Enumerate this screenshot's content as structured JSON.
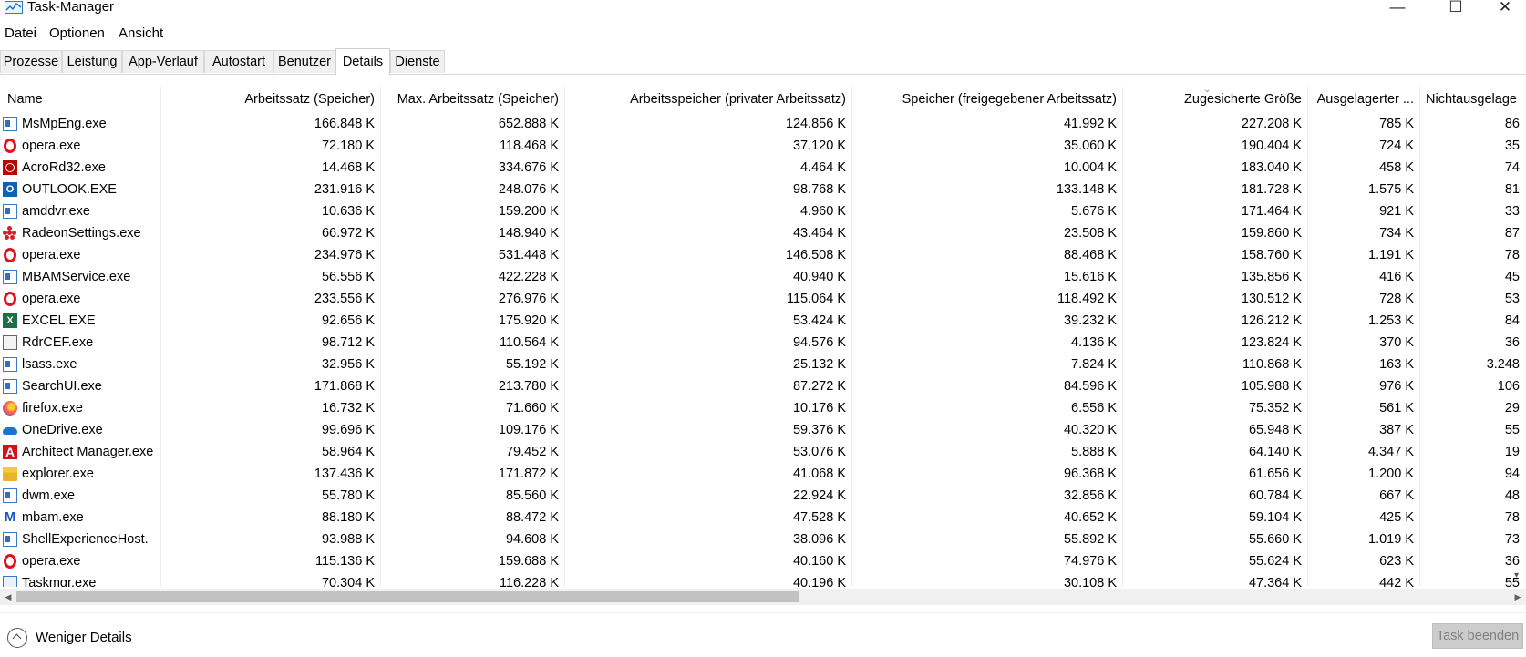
{
  "window": {
    "title": "Task-Manager",
    "app_icon": "task-manager-icon",
    "controls": {
      "minimize": "—",
      "maximize": "☐",
      "close": "✕"
    }
  },
  "menu": [
    "Datei",
    "Optionen",
    "Ansicht"
  ],
  "tabs": [
    {
      "label": "Prozesse"
    },
    {
      "label": "Leistung"
    },
    {
      "label": "App-Verlauf"
    },
    {
      "label": "Autostart"
    },
    {
      "label": "Benutzer"
    },
    {
      "label": "Details",
      "active": true
    },
    {
      "label": "Dienste"
    }
  ],
  "table": {
    "columns": [
      "Name",
      "Arbeitssatz (Speicher)",
      "Max. Arbeitssatz (Speicher)",
      "Arbeitsspeicher (privater Arbeitssatz)",
      "Speicher (freigegebener Arbeitssatz)",
      "Zugesicherte Größe",
      "Ausgelagerter ...",
      "Nichtausgelage"
    ],
    "sorted_column": "Zugesicherte Größe",
    "rows": [
      {
        "name": "MsMpEng.exe",
        "icon": "window-icon",
        "ws": "166.848 K",
        "max_ws": "652.888 K",
        "private": "124.856 K",
        "shared": "41.992 K",
        "commit": "227.208 K",
        "paged": "785 K",
        "nonpaged": "86"
      },
      {
        "name": "opera.exe",
        "icon": "opera-icon",
        "ws": "72.180 K",
        "max_ws": "118.468 K",
        "private": "37.120 K",
        "shared": "35.060 K",
        "commit": "190.404 K",
        "paged": "724 K",
        "nonpaged": "35"
      },
      {
        "name": "AcroRd32.exe",
        "icon": "acrobat-icon",
        "ws": "14.468 K",
        "max_ws": "334.676 K",
        "private": "4.464 K",
        "shared": "10.004 K",
        "commit": "183.040 K",
        "paged": "458 K",
        "nonpaged": "74"
      },
      {
        "name": "OUTLOOK.EXE",
        "icon": "outlook-icon",
        "ws": "231.916 K",
        "max_ws": "248.076 K",
        "private": "98.768 K",
        "shared": "133.148 K",
        "commit": "181.728 K",
        "paged": "1.575 K",
        "nonpaged": "81"
      },
      {
        "name": "amddvr.exe",
        "icon": "window-icon",
        "ws": "10.636 K",
        "max_ws": "159.200 K",
        "private": "4.960 K",
        "shared": "5.676 K",
        "commit": "171.464 K",
        "paged": "921 K",
        "nonpaged": "33"
      },
      {
        "name": "RadeonSettings.exe",
        "icon": "radeon-icon",
        "ws": "66.972 K",
        "max_ws": "148.940 K",
        "private": "43.464 K",
        "shared": "23.508 K",
        "commit": "159.860 K",
        "paged": "734 K",
        "nonpaged": "87"
      },
      {
        "name": "opera.exe",
        "icon": "opera-icon",
        "ws": "234.976 K",
        "max_ws": "531.448 K",
        "private": "146.508 K",
        "shared": "88.468 K",
        "commit": "158.760 K",
        "paged": "1.191 K",
        "nonpaged": "78"
      },
      {
        "name": "MBAMService.exe",
        "icon": "window-icon",
        "ws": "56.556 K",
        "max_ws": "422.228 K",
        "private": "40.940 K",
        "shared": "15.616 K",
        "commit": "135.856 K",
        "paged": "416 K",
        "nonpaged": "45"
      },
      {
        "name": "opera.exe",
        "icon": "opera-icon",
        "ws": "233.556 K",
        "max_ws": "276.976 K",
        "private": "115.064 K",
        "shared": "118.492 K",
        "commit": "130.512 K",
        "paged": "728 K",
        "nonpaged": "53"
      },
      {
        "name": "EXCEL.EXE",
        "icon": "excel-icon",
        "ws": "92.656 K",
        "max_ws": "175.920 K",
        "private": "53.424 K",
        "shared": "39.232 K",
        "commit": "126.212 K",
        "paged": "1.253 K",
        "nonpaged": "84"
      },
      {
        "name": "RdrCEF.exe",
        "icon": "rdrcef-icon",
        "ws": "98.712 K",
        "max_ws": "110.564 K",
        "private": "94.576 K",
        "shared": "4.136 K",
        "commit": "123.824 K",
        "paged": "370 K",
        "nonpaged": "36"
      },
      {
        "name": "lsass.exe",
        "icon": "window-icon",
        "ws": "32.956 K",
        "max_ws": "55.192 K",
        "private": "25.132 K",
        "shared": "7.824 K",
        "commit": "110.868 K",
        "paged": "163 K",
        "nonpaged": "3.248"
      },
      {
        "name": "SearchUI.exe",
        "icon": "window-icon",
        "ws": "171.868 K",
        "max_ws": "213.780 K",
        "private": "87.272 K",
        "shared": "84.596 K",
        "commit": "105.988 K",
        "paged": "976 K",
        "nonpaged": "106"
      },
      {
        "name": "firefox.exe",
        "icon": "firefox-icon",
        "ws": "16.732 K",
        "max_ws": "71.660 K",
        "private": "10.176 K",
        "shared": "6.556 K",
        "commit": "75.352 K",
        "paged": "561 K",
        "nonpaged": "29"
      },
      {
        "name": "OneDrive.exe",
        "icon": "onedrive-icon",
        "ws": "99.696 K",
        "max_ws": "109.176 K",
        "private": "59.376 K",
        "shared": "40.320 K",
        "commit": "65.948 K",
        "paged": "387 K",
        "nonpaged": "55"
      },
      {
        "name": "Architect Manager.exe",
        "icon": "architect-icon",
        "ws": "58.964 K",
        "max_ws": "79.452 K",
        "private": "53.076 K",
        "shared": "5.888 K",
        "commit": "64.140 K",
        "paged": "4.347 K",
        "nonpaged": "19"
      },
      {
        "name": "explorer.exe",
        "icon": "explorer-icon",
        "ws": "137.436 K",
        "max_ws": "171.872 K",
        "private": "41.068 K",
        "shared": "96.368 K",
        "commit": "61.656 K",
        "paged": "1.200 K",
        "nonpaged": "94"
      },
      {
        "name": "dwm.exe",
        "icon": "window-icon",
        "ws": "55.780 K",
        "max_ws": "85.560 K",
        "private": "22.924 K",
        "shared": "32.856 K",
        "commit": "60.784 K",
        "paged": "667 K",
        "nonpaged": "48"
      },
      {
        "name": "mbam.exe",
        "icon": "malwarebytes-icon",
        "ws": "88.180 K",
        "max_ws": "88.472 K",
        "private": "47.528 K",
        "shared": "40.652 K",
        "commit": "59.104 K",
        "paged": "425 K",
        "nonpaged": "78"
      },
      {
        "name": "ShellExperienceHost.",
        "icon": "window-icon",
        "ws": "93.988 K",
        "max_ws": "94.608 K",
        "private": "38.096 K",
        "shared": "55.892 K",
        "commit": "55.660 K",
        "paged": "1.019 K",
        "nonpaged": "73"
      },
      {
        "name": "opera.exe",
        "icon": "opera-icon",
        "ws": "115.136 K",
        "max_ws": "159.688 K",
        "private": "40.160 K",
        "shared": "74.976 K",
        "commit": "55.624 K",
        "paged": "623 K",
        "nonpaged": "36"
      },
      {
        "name": "Taskmgr.exe",
        "icon": "task-manager-icon",
        "ws": "70.304 K",
        "max_ws": "116.228 K",
        "private": "40.196 K",
        "shared": "30.108 K",
        "commit": "47.364 K",
        "paged": "442 K",
        "nonpaged": "55"
      }
    ]
  },
  "footer": {
    "fewer_details": "Weniger Details",
    "end_task": "Task beenden"
  }
}
